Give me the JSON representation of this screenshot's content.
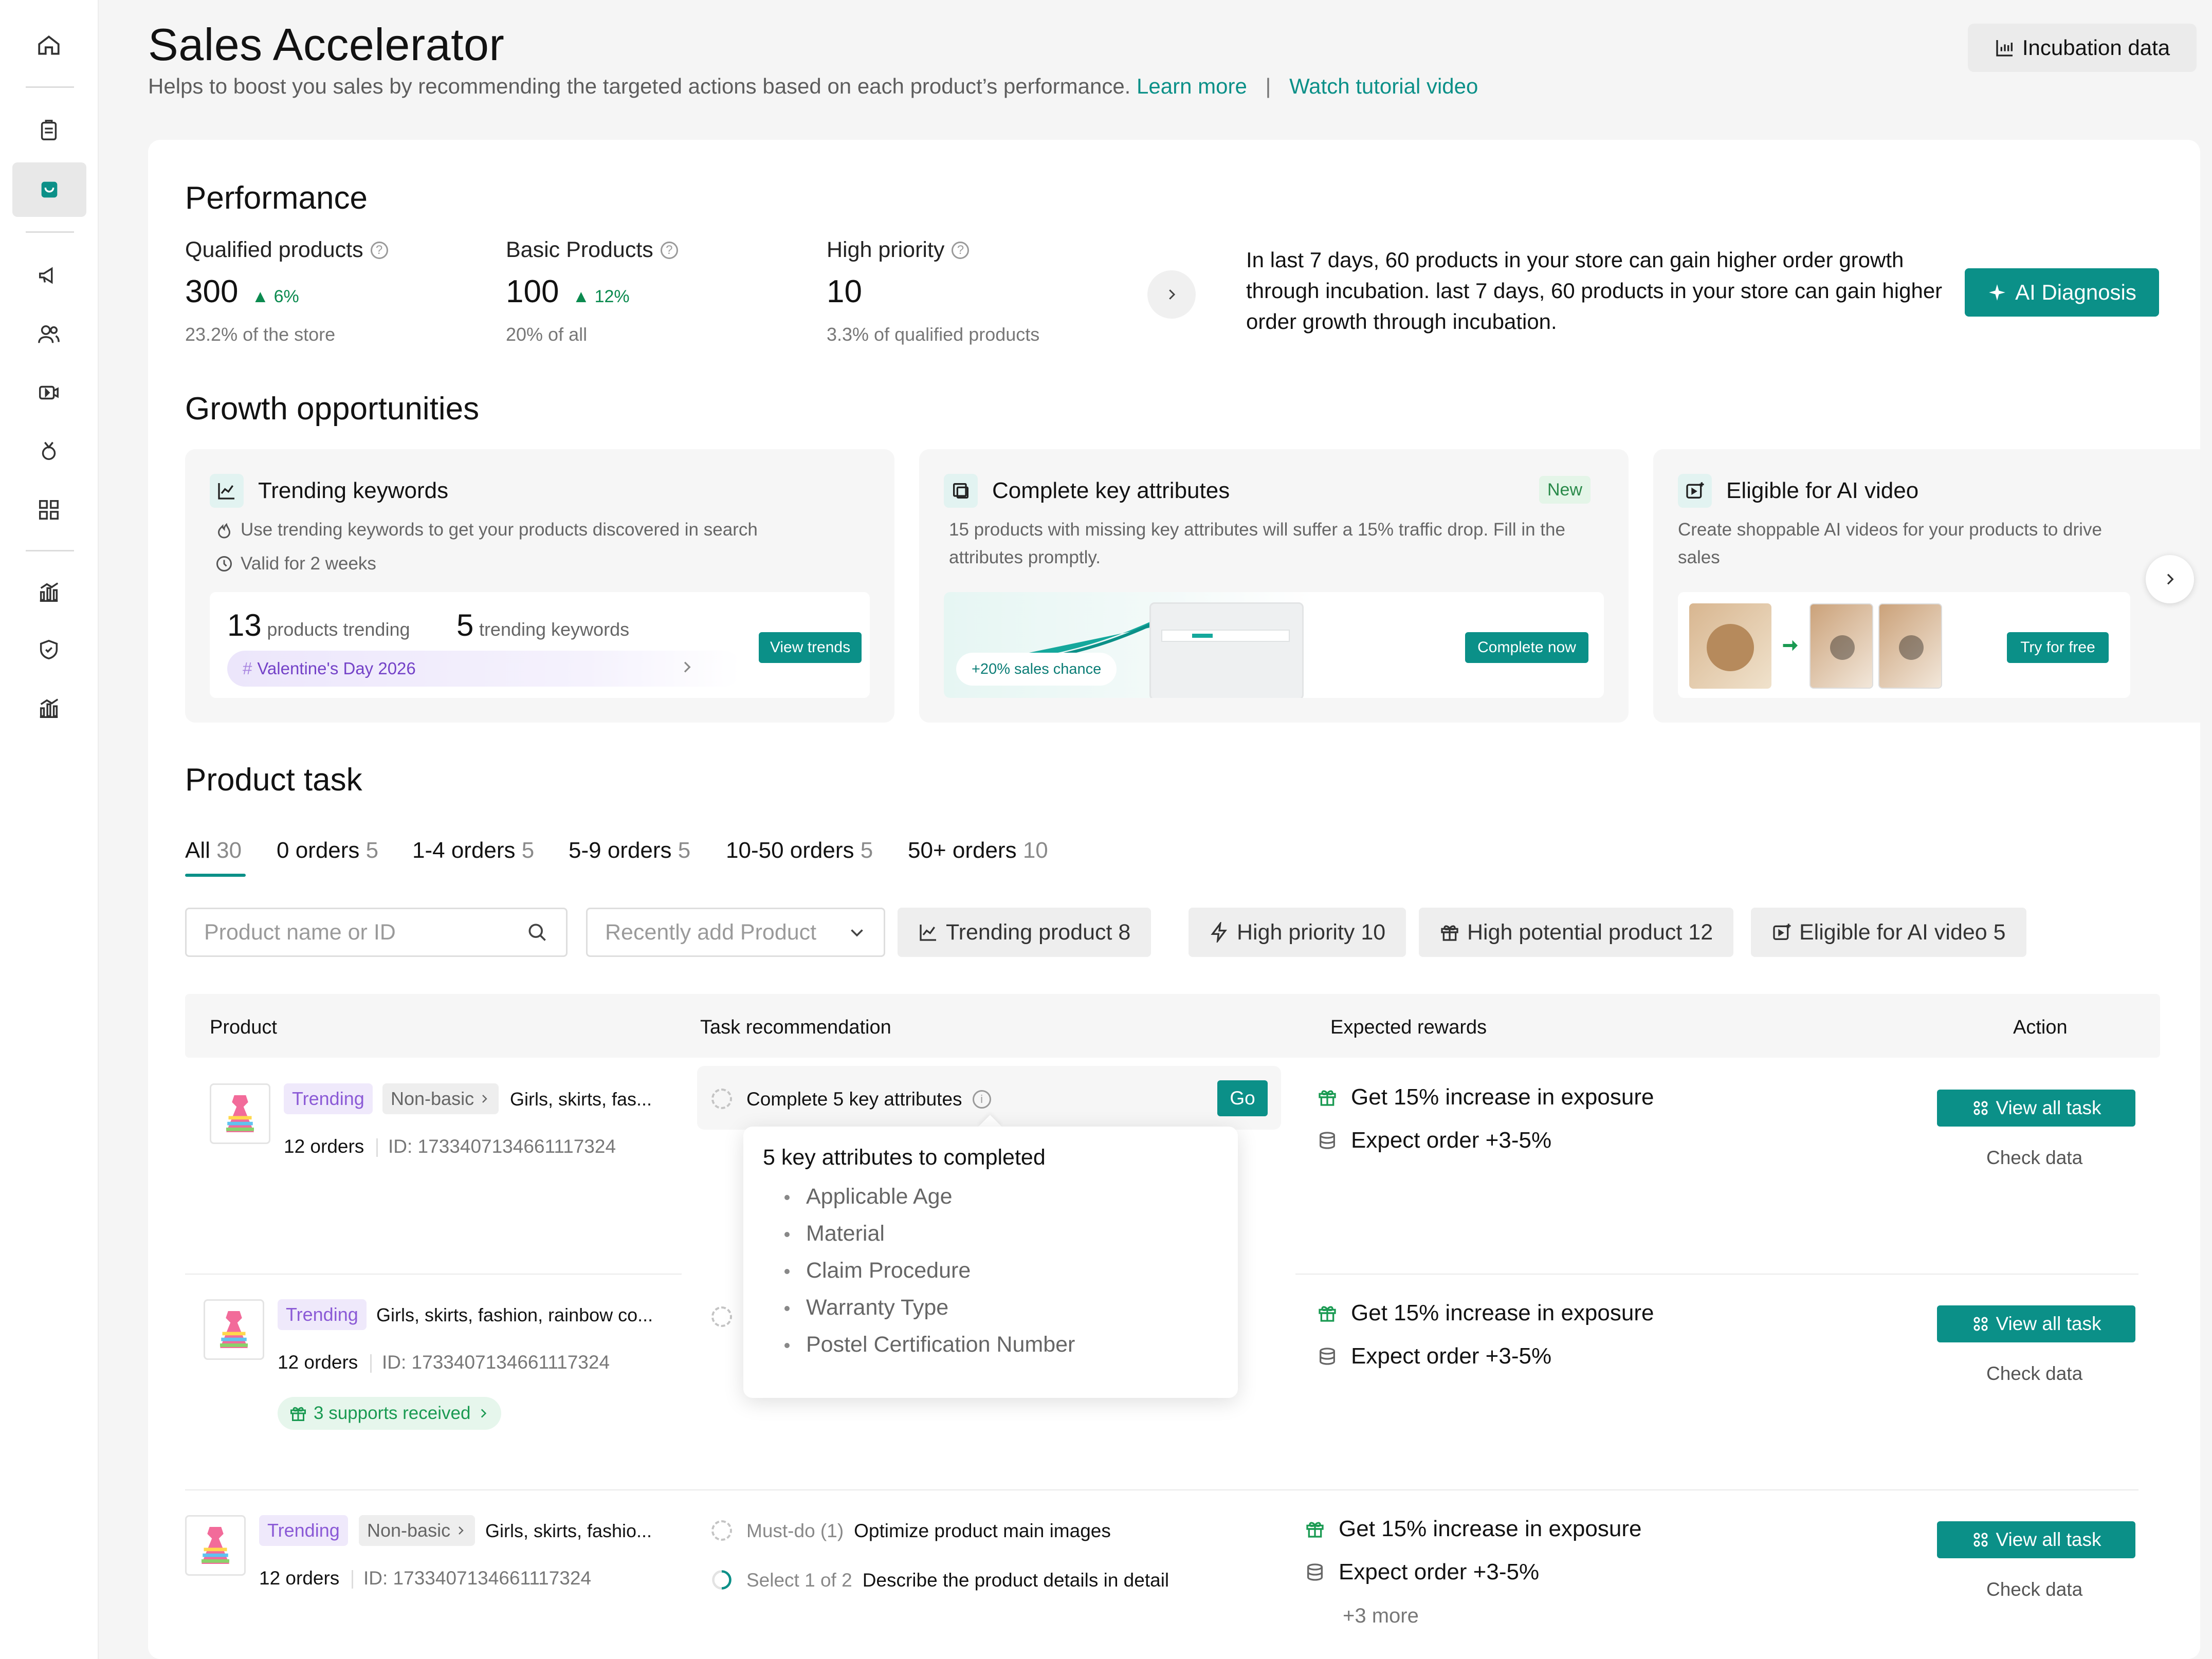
{
  "header": {
    "title": "Sales Accelerator",
    "subtitle": "Helps to boost you sales by recommending the targeted actions based on each product’s performance.",
    "learn_more": "Learn more",
    "separator": "|",
    "tutorial": "Watch tutorial video",
    "incubation_button": "Incubation data"
  },
  "performance": {
    "title": "Performance",
    "metrics": [
      {
        "label": "Qualified products",
        "value": "300",
        "change": "6%",
        "sub": "23.2% of the store"
      },
      {
        "label": "Basic Products",
        "value": "100",
        "change": "12%",
        "sub": "20% of all"
      },
      {
        "label": "High priority",
        "value": "10",
        "change": "",
        "sub": "3.3% of qualified products"
      }
    ],
    "insight": "In last 7 days, 60 products in your store can gain higher order growth through incubation. last 7 days, 60 products in your store can gain higher order growth through incubation.",
    "ai_button": "AI Diagnosis"
  },
  "growth": {
    "title": "Growth opportunities",
    "cards": [
      {
        "title": "Trending keywords",
        "desc": "Use trending keywords to get your products discovered in search",
        "valid": "Valid for 2 weeks",
        "count1": "13",
        "count1_label": "products trending",
        "count2": "5",
        "count2_label": "trending keywords",
        "tag": "Valentine's Day 2026",
        "button": "View trends"
      },
      {
        "title": "Complete key attributes",
        "badge": "New",
        "desc": "15 products with missing key attributes will suffer a 15% traffic drop. Fill in the attributes promptly.",
        "chance": "+20% sales chance",
        "button": "Complete now"
      },
      {
        "title": "Eligible for AI video",
        "desc": "Create shoppable AI videos for your products to drive sales",
        "button": "Try for free"
      }
    ]
  },
  "product_task": {
    "title": "Product task",
    "tabs": [
      {
        "label": "All",
        "count": "30"
      },
      {
        "label": "0 orders",
        "count": "5"
      },
      {
        "label": "1-4 orders",
        "count": "5"
      },
      {
        "label": "5-9 orders",
        "count": "5"
      },
      {
        "label": "10-50 orders",
        "count": "5"
      },
      {
        "label": "50+ orders",
        "count": "10"
      }
    ],
    "search_placeholder": "Product name or ID",
    "sort_select": "Recently add Product",
    "chips": [
      "Trending product 8",
      "High priority 10",
      "High potential product 12",
      "Eligible for AI video 5"
    ],
    "columns": [
      "Product",
      "Task recommendation",
      "Expected rewards",
      "Action"
    ],
    "rows": [
      {
        "tag_trending": "Trending",
        "tag_basic": "Non-basic",
        "name": "Girls, skirts, fas...",
        "orders": "12 orders",
        "id": "ID: 1733407134661117324",
        "task": "Complete 5 key attributes",
        "task_button": "Go",
        "reward1": "Get 15% increase in exposure",
        "reward2": "Expect order +3-5%",
        "view_all": "View all task",
        "check": "Check data"
      },
      {
        "tag_trending": "Trending",
        "name": "Girls, skirts, fashion, rainbow co...",
        "orders": "12 orders",
        "id": "ID: 1733407134661117324",
        "supports": "3 supports received",
        "reward1": "Get 15% increase in exposure",
        "reward2": "Expect order +3-5%",
        "view_all": "View all task",
        "check": "Check data"
      },
      {
        "tag_trending": "Trending",
        "tag_basic": "Non-basic",
        "name": "Girls, skirts, fashio...",
        "orders": "12 orders",
        "id": "ID: 1733407134661117324",
        "task1_prefix": "Must-do (1)",
        "task1": "Optimize product main images",
        "task2_prefix": "Select 1 of 2",
        "task2": "Describe the product details in detail",
        "reward1": "Get 15% increase in exposure",
        "reward2": "Expect order +3-5%",
        "more": "+3 more",
        "view_all": "View all task",
        "check": "Check data"
      }
    ],
    "popover": {
      "title": "5 key attributes to completed",
      "items": [
        "Applicable Age",
        "Material",
        "Claim Procedure",
        "Warranty Type",
        "Postel Certification Number"
      ]
    }
  },
  "colors": {
    "accent": "#0b9088",
    "trending": "#8b5ad6",
    "up": "#0b8a4f"
  },
  "sidebar_icons": [
    "home-icon",
    "clipboard-icon",
    "store-icon",
    "megaphone-icon",
    "users-icon",
    "video-icon",
    "medal-icon",
    "grid-icon",
    "bar-chart-icon",
    "shield-icon",
    "bar-chart-icon"
  ]
}
